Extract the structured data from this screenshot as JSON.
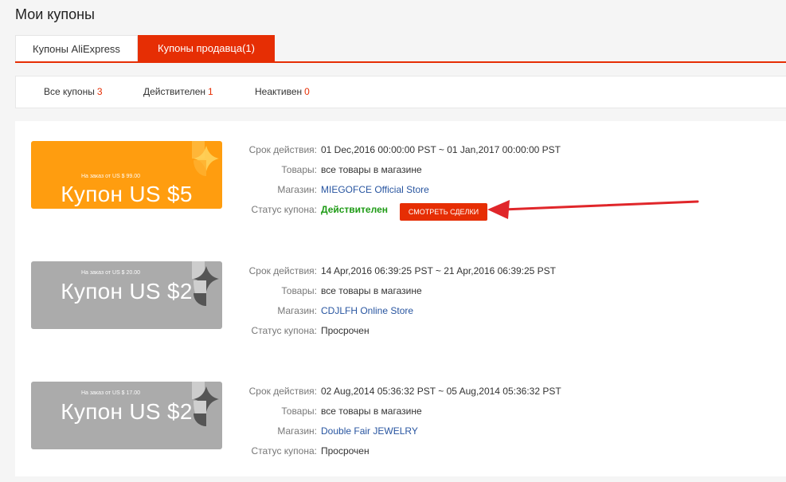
{
  "page": {
    "title": "Мои купоны"
  },
  "tabs": [
    {
      "label": "Купоны AliExpress"
    },
    {
      "label": "Купоны продавца(1)"
    }
  ],
  "filters": [
    {
      "label": "Все купоны",
      "count": "3"
    },
    {
      "label": "Действителен",
      "count": "1"
    },
    {
      "label": "Неактивен",
      "count": "0"
    }
  ],
  "labels": {
    "validity": "Срок действия:",
    "goods": "Товары:",
    "store": "Магазин:",
    "status": "Статус купона:"
  },
  "coupons": [
    {
      "min_order": "На заказ от US $ 99.00",
      "amount": "Купон US $5",
      "validity": "01 Dec,2016 00:00:00 PST ~ 01 Jan,2017 00:00:00 PST",
      "goods": "все товары в магазине",
      "store": "MIEGOFCE Official Store",
      "status": "Действителен",
      "action": "СМОТРЕТЬ СДЕЛКИ",
      "color": "#ff9d0f"
    },
    {
      "min_order": "На заказ от US $ 20.00",
      "amount": "Купон US $2",
      "validity": "14 Apr,2016 06:39:25 PST ~ 21 Apr,2016 06:39:25 PST",
      "goods": "все товары в магазине",
      "store": "CDJLFH Online Store",
      "status": "Просрочен",
      "color": "#ababab"
    },
    {
      "min_order": "На заказ от US $ 17.00",
      "amount": "Купон US $2",
      "validity": "02 Aug,2014 05:36:32 PST ~ 05 Aug,2014 05:36:32 PST",
      "goods": "все товары в магазине",
      "store": "Double Fair JEWELRY",
      "status": "Просрочен",
      "color": "#ababab"
    }
  ],
  "colors": {
    "accent": "#e62e04",
    "valid": "#1e9b15",
    "link": "#2855a0"
  }
}
